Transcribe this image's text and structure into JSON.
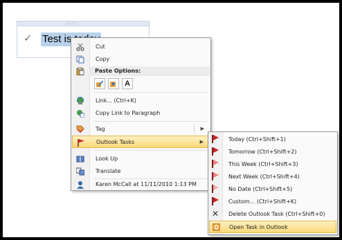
{
  "note": {
    "text": "Test is today",
    "grip": "::::::",
    "dots": "..."
  },
  "context_menu": {
    "items": [
      {
        "label": "Cut",
        "icon": "scissors-icon"
      },
      {
        "label": "Copy",
        "icon": "copy-icon"
      },
      {
        "label": "Link...  (Ctrl+K)",
        "icon": "link-icon"
      },
      {
        "label": "Copy Link to Paragraph",
        "icon": "copy-link-icon"
      },
      {
        "label": "Tag",
        "icon": "tag-icon"
      },
      {
        "label": "Outlook Tasks",
        "icon": "flag-icon"
      },
      {
        "label": "Look Up",
        "icon": "book-icon"
      },
      {
        "label": "Translate",
        "icon": "translate-icon"
      },
      {
        "label": "Karen McCall at 11/11/2010 1:13 PM",
        "icon": "author-icon"
      }
    ],
    "paste_header": "Paste Options:",
    "paste_buttons": [
      "",
      "",
      "A"
    ]
  },
  "submenu": {
    "items": [
      {
        "label": "Today  (Ctrl+Shift+1)"
      },
      {
        "label": "Tomorrow  (Ctrl+Shift+2)"
      },
      {
        "label": "This Week  (Ctrl+Shift+3)"
      },
      {
        "label": "Next Week  (Ctrl+Shift+4)"
      },
      {
        "label": "No Date  (Ctrl+Shift+5)"
      },
      {
        "label": "Custom...  (Ctrl+Shift+K)"
      },
      {
        "label": "Delete Outlook Task  (Ctrl+Shift+0)"
      },
      {
        "label": "Open Task in Outlook"
      }
    ]
  },
  "glyphs": {
    "check": "✓",
    "arrow": "▶",
    "delete": "✕"
  },
  "colors": {
    "highlight_bg": "#fbd97a",
    "selection": "#b9d1ea",
    "flag_red": "#c62828"
  }
}
